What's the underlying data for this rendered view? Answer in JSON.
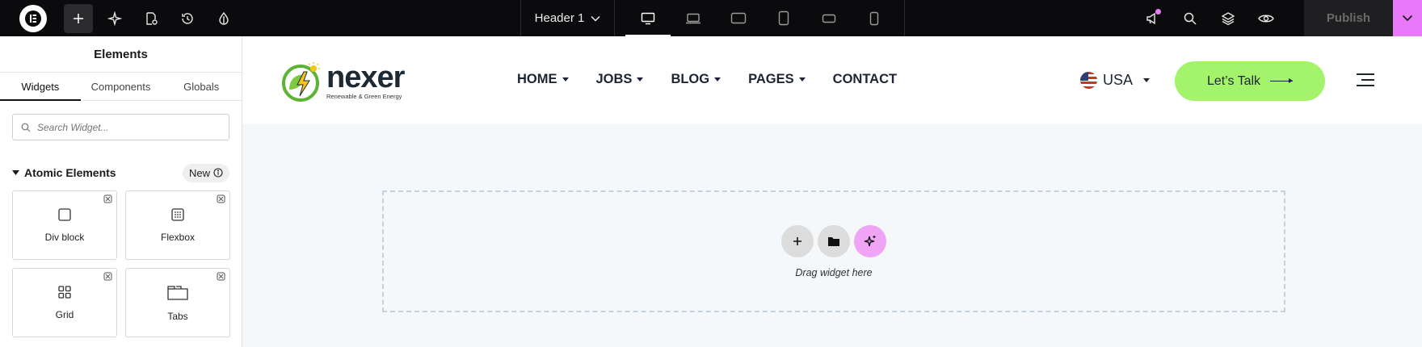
{
  "topbar": {
    "document_name": "Header 1",
    "publish_label": "Publish",
    "icons": [
      "elementor-logo-icon",
      "plus-icon",
      "sparkle-icon",
      "page-settings-icon",
      "history-icon",
      "theme-style-icon"
    ],
    "devices": [
      "desktop",
      "laptop",
      "tablet-landscape",
      "tablet-portrait",
      "mobile-landscape",
      "mobile-portrait"
    ],
    "active_device": "desktop",
    "right_icons": [
      "announcements-icon",
      "search-icon",
      "structure-icon",
      "preview-icon"
    ],
    "accent_color": "#e879f9"
  },
  "sidebar": {
    "title": "Elements",
    "tabs": [
      {
        "label": "Widgets",
        "active": true
      },
      {
        "label": "Components",
        "active": false
      },
      {
        "label": "Globals",
        "active": false
      }
    ],
    "search": {
      "placeholder": "Search Widget...",
      "value": ""
    },
    "section": {
      "title": "Atomic Elements",
      "badge": "New"
    },
    "widgets": [
      {
        "label": "Div block",
        "icon": "square-icon"
      },
      {
        "label": "Flexbox",
        "icon": "flexbox-icon"
      },
      {
        "label": "Grid",
        "icon": "grid-icon"
      },
      {
        "label": "Tabs",
        "icon": "tabs-icon"
      }
    ]
  },
  "site": {
    "brand": {
      "name": "nexer",
      "tagline": "Renewable & Green Energy"
    },
    "nav": [
      {
        "label": "HOME",
        "has_dropdown": true
      },
      {
        "label": "JOBS",
        "has_dropdown": true
      },
      {
        "label": "BLOG",
        "has_dropdown": true
      },
      {
        "label": "PAGES",
        "has_dropdown": true
      },
      {
        "label": "CONTACT",
        "has_dropdown": false
      }
    ],
    "language": "USA",
    "cta": "Let’s Talk",
    "cta_color": "#a3f36b"
  },
  "canvas": {
    "drop_text": "Drag widget here"
  }
}
